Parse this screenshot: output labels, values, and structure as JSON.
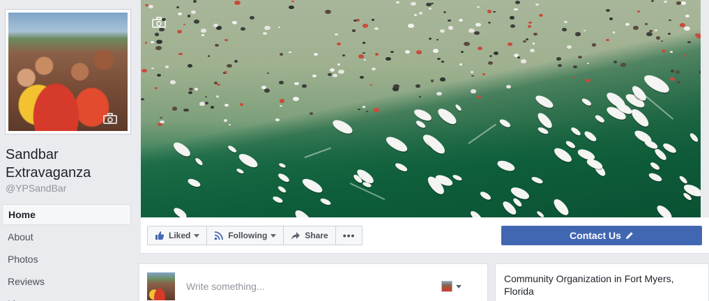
{
  "page": {
    "name": "Sandbar Extravaganza",
    "handle": "@YPSandBar"
  },
  "nav": {
    "items": [
      {
        "label": "Home",
        "active": true
      },
      {
        "label": "About",
        "active": false
      },
      {
        "label": "Photos",
        "active": false
      },
      {
        "label": "Reviews",
        "active": false
      },
      {
        "label": "Li",
        "active": false
      }
    ]
  },
  "actions": {
    "liked_label": "Liked",
    "following_label": "Following",
    "share_label": "Share",
    "more_label": "•••",
    "contact_label": "Contact Us"
  },
  "composer": {
    "placeholder": "Write something..."
  },
  "about": {
    "category_line": "Community Organization in Fort Myers, Florida"
  },
  "colors": {
    "primary": "#4267b2",
    "background": "#e9ebee",
    "link_icon": "#4267b2"
  },
  "icons": [
    "camera-icon",
    "thumbs-up-icon",
    "rss-icon",
    "share-arrow-icon",
    "more-icon",
    "pencil-icon",
    "chevron-down-icon"
  ]
}
